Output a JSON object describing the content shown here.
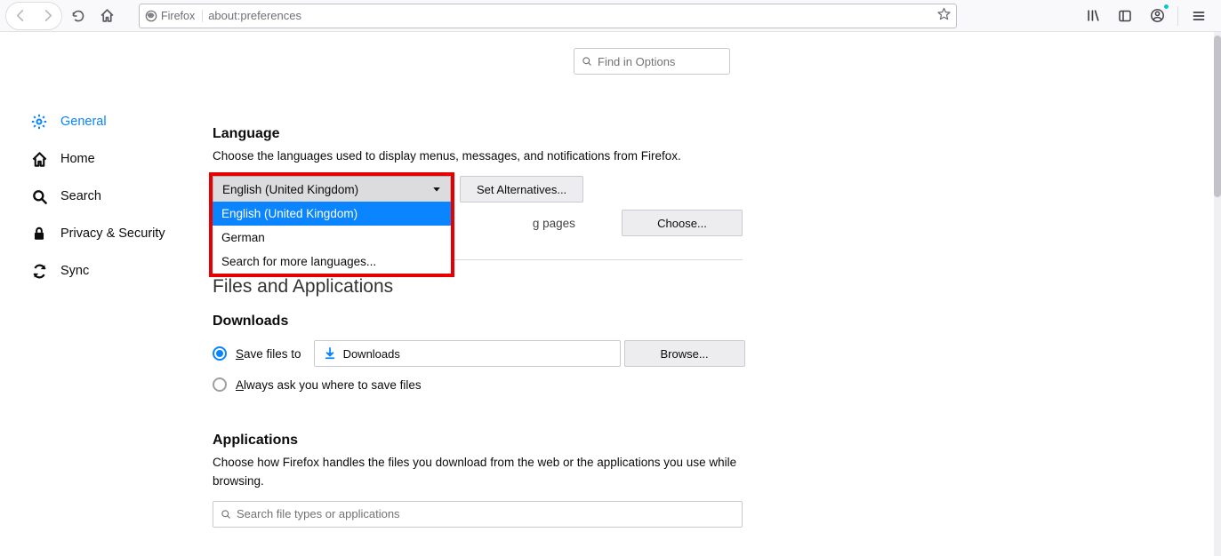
{
  "toolbar": {
    "identity_label": "Firefox",
    "url": "about:preferences"
  },
  "search": {
    "find_placeholder": "Find in Options",
    "app_search_placeholder": "Search file types or applications"
  },
  "sidebar": {
    "items": [
      {
        "label": "General"
      },
      {
        "label": "Home"
      },
      {
        "label": "Search"
      },
      {
        "label": "Privacy & Security"
      },
      {
        "label": "Sync"
      }
    ]
  },
  "language": {
    "heading": "Language",
    "description": "Choose the languages used to display menus, messages, and notifications from Firefox.",
    "selected": "English (United Kingdom)",
    "options": [
      "English (United Kingdom)",
      "German",
      "Search for more languages..."
    ],
    "set_alternatives_label": "Set Alternatives...",
    "reading_pages_fragment": "g pages",
    "choose_label": "Choose..."
  },
  "files": {
    "big_heading": "Files and Applications",
    "downloads_heading": "Downloads",
    "save_files_to_label": "Save files to",
    "downloads_folder": "Downloads",
    "browse_label": "Browse...",
    "always_ask_label": "Always ask you where to save files"
  },
  "applications": {
    "heading": "Applications",
    "description": "Choose how Firefox handles the files you download from the web or the applications you use while browsing."
  }
}
